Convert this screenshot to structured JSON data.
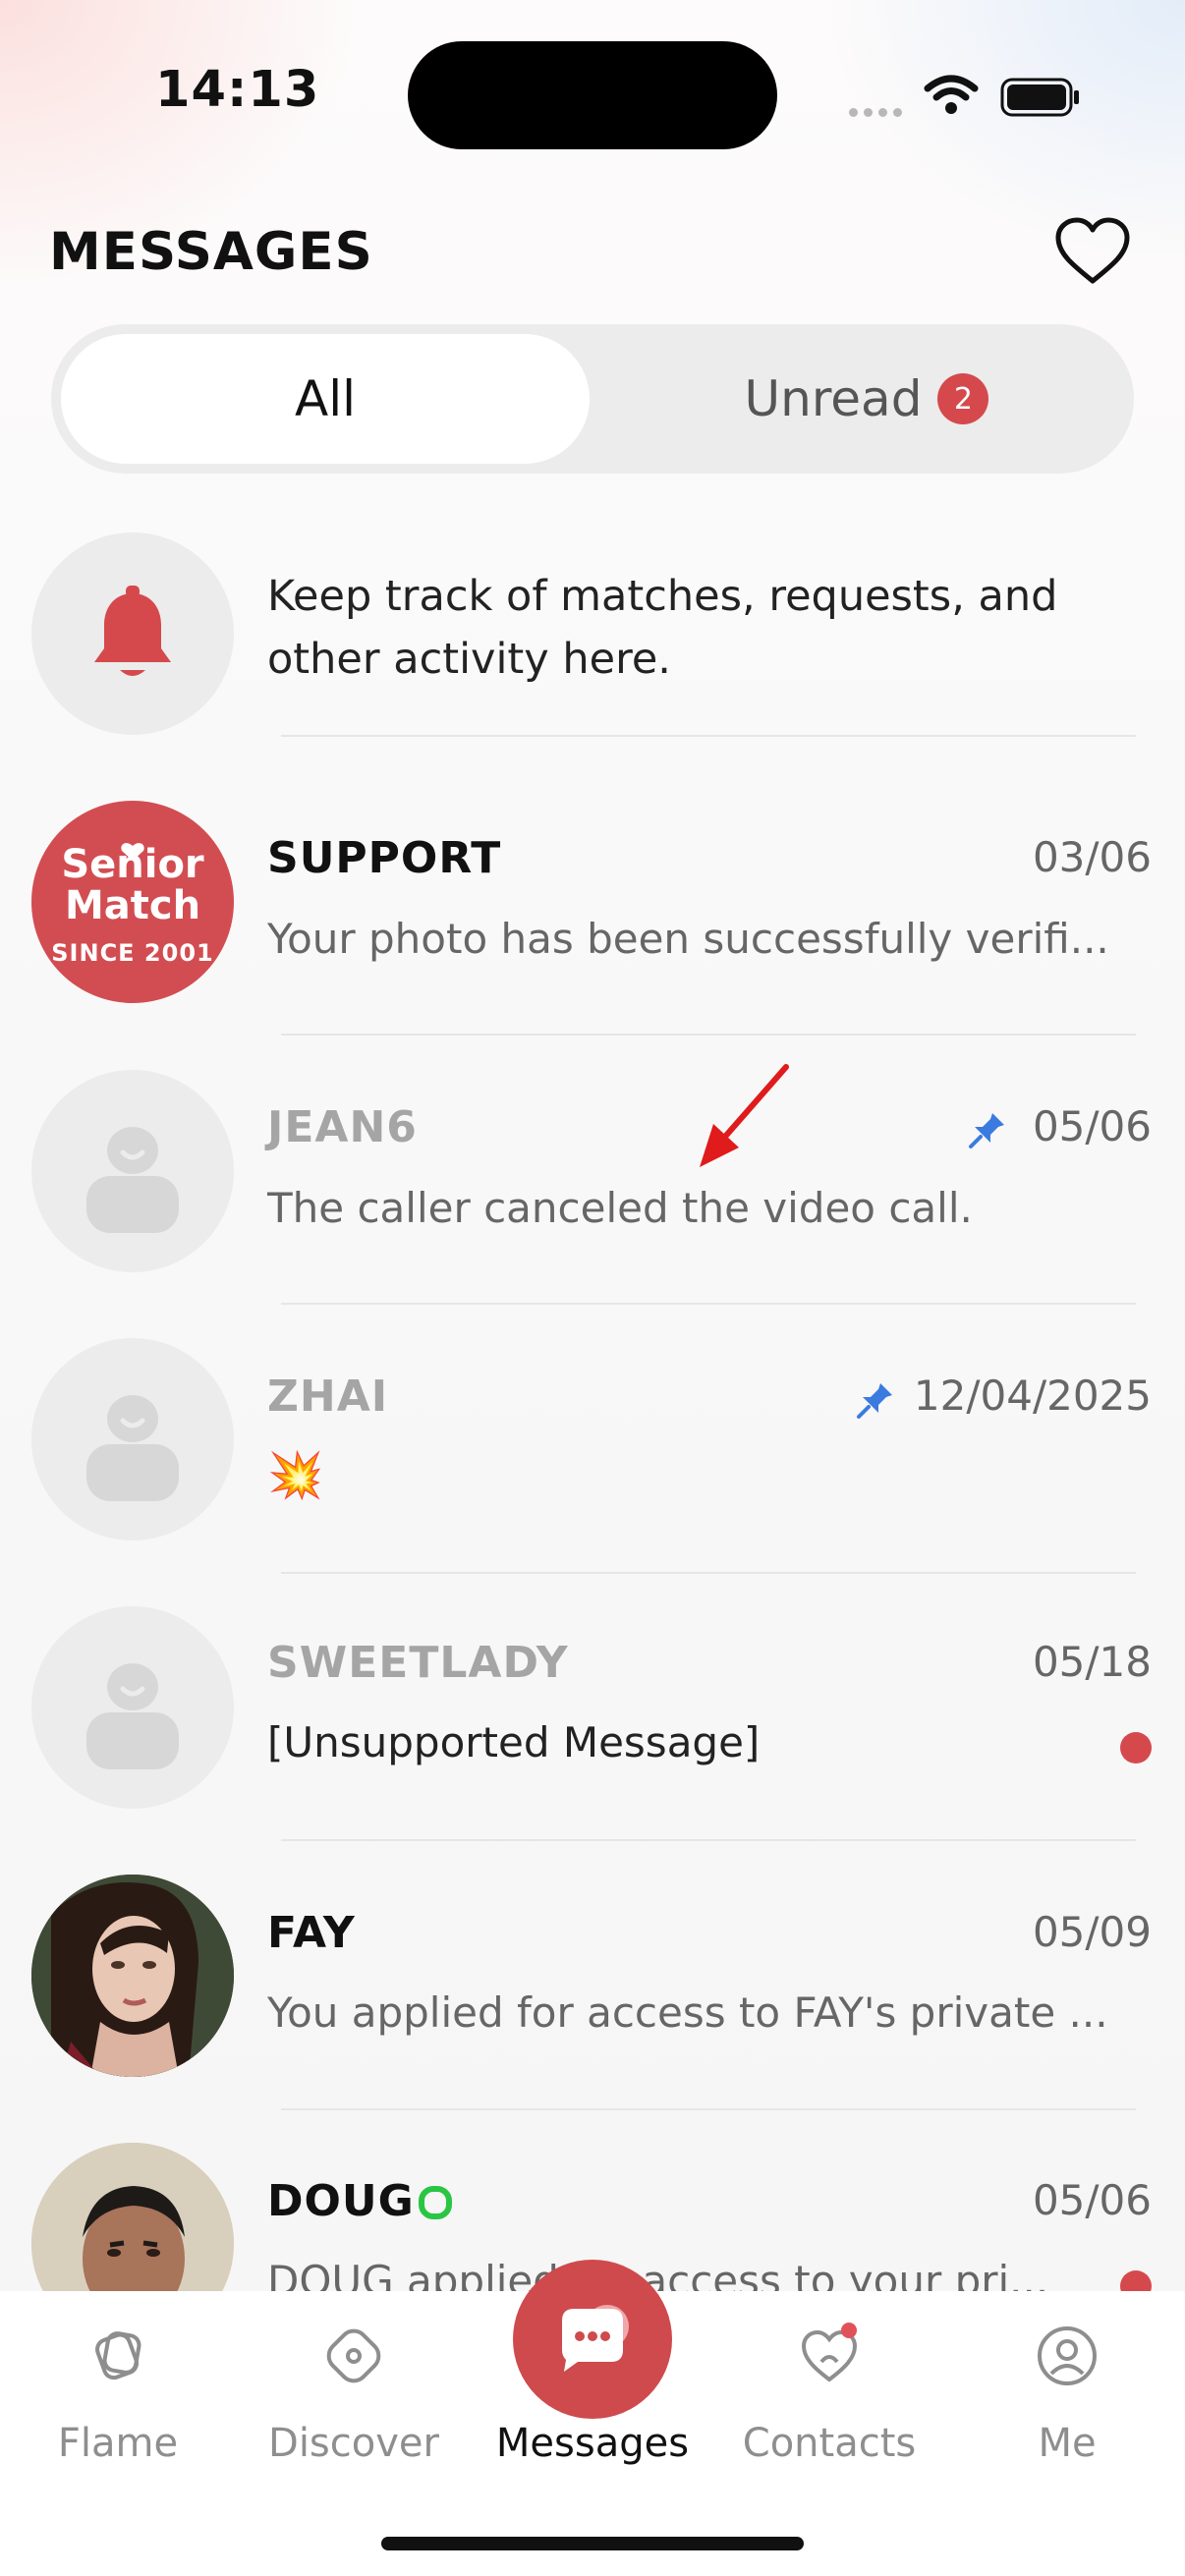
{
  "status_bar": {
    "time": "14:13"
  },
  "header": {
    "title": "MESSAGES"
  },
  "segments": {
    "all_label": "All",
    "unread_label": "Unread",
    "unread_count": "2"
  },
  "activity": {
    "text": "Keep track of matches, requests, and other activity here."
  },
  "conversations": [
    {
      "name": "SUPPORT",
      "date": "03/06",
      "preview": "Your photo has been successfully verifi..."
    },
    {
      "name": "JEAN6",
      "date": "05/06",
      "preview": "The caller canceled the video call.",
      "pinned": true
    },
    {
      "name": "ZHAI",
      "date": "12/04/2025",
      "preview": "💥",
      "pinned": true
    },
    {
      "name": "SWEETLADY",
      "date": "05/18",
      "preview": "[Unsupported Message]",
      "unread": true
    },
    {
      "name": "FAY",
      "date": "05/09",
      "preview": "You applied for access to FAY's private ..."
    },
    {
      "name": "DOUG",
      "date": "05/06",
      "preview": "DOUG applied for access to your pri...",
      "online": true,
      "unread": true
    }
  ],
  "support_logo": {
    "line1": "Senior",
    "line2": "Match",
    "line3": "SINCE 2001",
    "color": "#d24d51"
  },
  "tabs": [
    {
      "label": "Flame",
      "icon": "flame-icon"
    },
    {
      "label": "Discover",
      "icon": "compass-icon"
    },
    {
      "label": "Messages",
      "icon": "chat-bubble-icon",
      "active": true
    },
    {
      "label": "Contacts",
      "icon": "heart-contacts-icon"
    },
    {
      "label": "Me",
      "icon": "profile-icon"
    }
  ],
  "colors": {
    "accent": "#d5494d",
    "online": "#2bc544",
    "pin": "#3b7be0"
  }
}
